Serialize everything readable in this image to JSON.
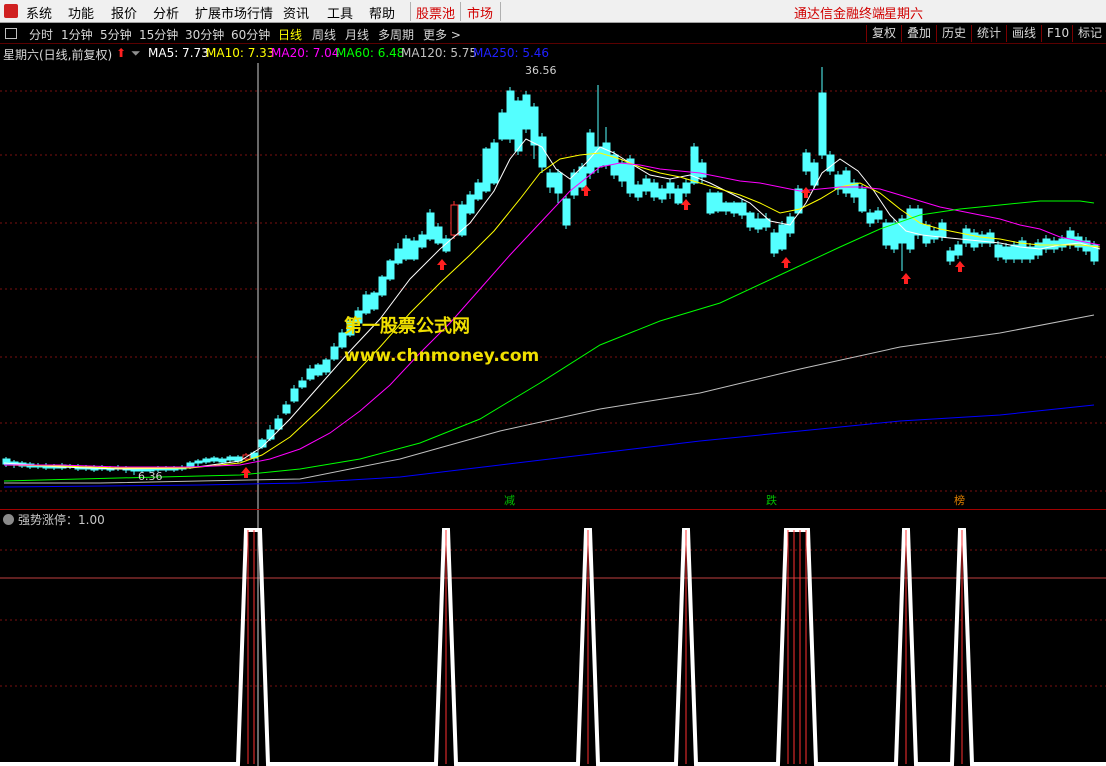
{
  "menu": {
    "items": [
      "系统",
      "功能",
      "报价",
      "分析",
      "扩展市场行情",
      "资讯",
      "工具",
      "帮助"
    ],
    "stock_pool": "股票池",
    "market": "市场",
    "promo": "通达信金融终端",
    "weekday": "星期六"
  },
  "toolbar": {
    "periods": [
      "分时",
      "1分钟",
      "5分钟",
      "15分钟",
      "30分钟",
      "60分钟",
      "日线",
      "周线",
      "月线",
      "多周期",
      "更多 >"
    ],
    "active_period": "日线",
    "right_buttons": [
      "复权",
      "叠加",
      "历史",
      "统计",
      "画线",
      "F10",
      "标记"
    ]
  },
  "chart_header": {
    "title": "星期六(日线,前复权)",
    "ma5": "MA5: 7.73",
    "ma10": "MA10: 7.33",
    "ma20": "MA20: 7.04",
    "ma60": "MA60: 6.48",
    "ma120": "MA120: 5.75",
    "ma250": "MA250: 5.46"
  },
  "price_labels": {
    "high": "36.56",
    "low": "6.36"
  },
  "markers": [
    {
      "text": "减",
      "color": "#00c000"
    },
    {
      "text": "跌",
      "color": "#00c000"
    },
    {
      "text": "榜",
      "color": "#e08000"
    }
  ],
  "watermark": {
    "line1": "第一股票公式网",
    "line2": "www.chnmoney.com"
  },
  "indicator": {
    "title": "强势涨停：1.00"
  },
  "colors": {
    "up": "#ff3232",
    "down": "#54ffff",
    "ma5": "#ffffff",
    "ma10": "#ffff00",
    "ma20": "#ff00ff",
    "ma60": "#00ff00",
    "ma120": "#c0c0c0",
    "ma250": "#0000ff"
  }
}
